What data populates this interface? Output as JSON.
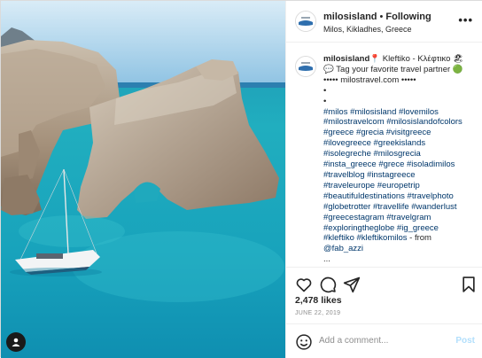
{
  "post": {
    "username": "milosisland",
    "separator": "•",
    "follow_label": "Following",
    "location": "Milos, Kikladhes, Greece",
    "more_icon": "more-options-icon"
  },
  "caption": {
    "username": "milosisland",
    "lines": [
      "📍 Kleftiko - Κλέφτικο 🏖",
      "💬 Tag your favorite travel partner 🟢",
      "••••• milostravel.com •••••",
      "•",
      "•"
    ],
    "hashtag_lines": [
      "#milos #milosisland #lovemilos",
      "#milostravelcom #milosislandofcolors",
      "#greece #grecia #visitgreece",
      "#ilovegreece #greekislands",
      "#isolegreche #milosgrecia",
      "#insta_greece #grece #isoladimilos",
      "#travelblog #instagreece",
      "#traveleurope #europetrip",
      "#beautifuldestinations #travelphoto",
      "#globetrotter #travellife #wanderlust",
      "#greecestagram #travelgram",
      "#exploringtheglobe #ig_greece",
      "#kleftiko #kleftikomilos"
    ],
    "from_text": " - from",
    "credit": "@fab_azzi",
    "trailing": "..."
  },
  "stats": {
    "likes": "2,478 likes",
    "date": "JUNE 22, 2019"
  },
  "comment_box": {
    "placeholder": "Add a comment...",
    "post_label": "Post"
  },
  "colors": {
    "sea": "#1fa3b5",
    "link": "#00376b",
    "post_disabled": "#b2dffc"
  },
  "icons": [
    "heart-icon",
    "comment-icon",
    "share-icon",
    "bookmark-icon",
    "emoji-icon",
    "user-tag-icon"
  ]
}
